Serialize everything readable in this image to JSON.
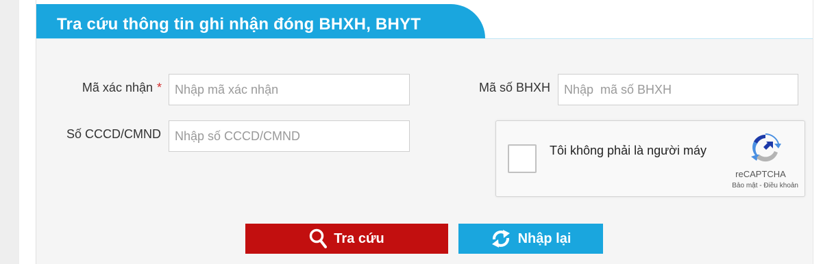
{
  "header": {
    "title": "Tra cứu thông tin ghi nhận đóng BHXH, BHYT"
  },
  "form": {
    "verify_code": {
      "label": "Mã xác nhận",
      "required_mark": "*",
      "placeholder": "Nhập mã xác nhận",
      "value": ""
    },
    "bhxh_number": {
      "label": "Mã số BHXH",
      "placeholder": "Nhập  mã số BHXH",
      "value": ""
    },
    "id_number": {
      "label": "Số CCCD/CMND",
      "placeholder": "Nhập số CCCD/CMND",
      "value": ""
    }
  },
  "captcha": {
    "text": "Tôi không phải là người máy",
    "brand": "reCAPTCHA",
    "privacy": "Bảo mật",
    "separator": " - ",
    "terms": "Điều khoản",
    "checked": false,
    "logo_icon": "recaptcha-icon"
  },
  "buttons": {
    "search": {
      "label": "Tra cứu",
      "icon": "search-icon",
      "color": "#c20f0f"
    },
    "reset": {
      "label": "Nhập lại",
      "icon": "refresh-icon",
      "color": "#1aa6de"
    }
  },
  "colors": {
    "accent": "#1aa6de",
    "danger": "#c20f0f"
  }
}
